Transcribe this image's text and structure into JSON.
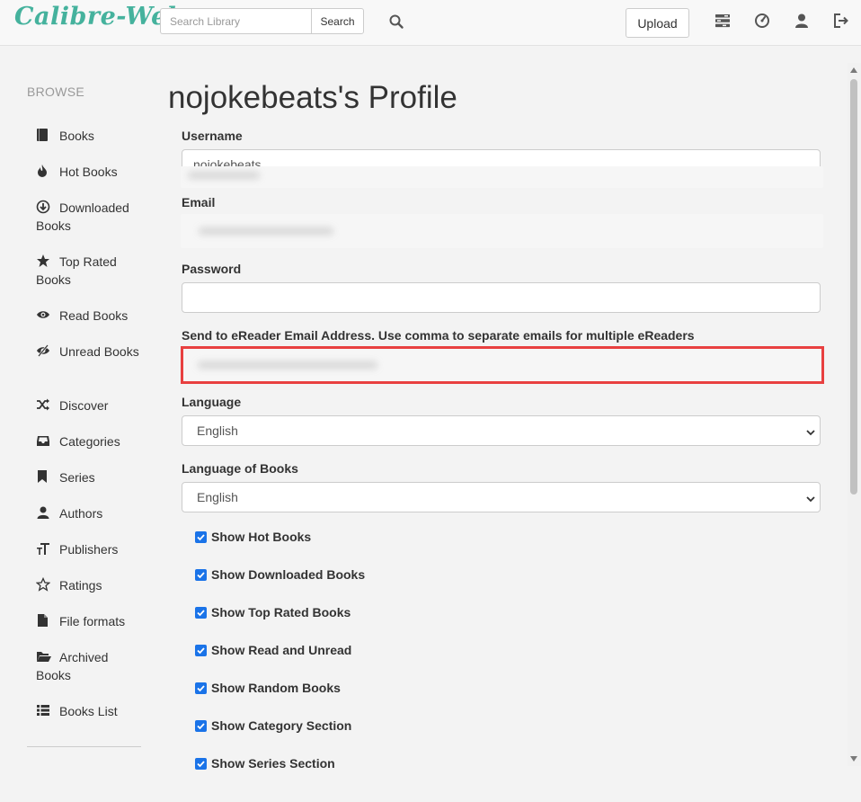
{
  "navbar": {
    "brand": "Calibre-Web",
    "search_placeholder": "Search Library",
    "search_button": "Search",
    "upload_button": "Upload",
    "icons": [
      "search-icon",
      "tasks-icon",
      "dashboard-icon",
      "user-icon",
      "logout-icon"
    ]
  },
  "sidebar": {
    "heading": "BROWSE",
    "items": [
      {
        "label": "Books",
        "icon": "book-icon"
      },
      {
        "label": "Hot Books",
        "icon": "fire-icon"
      },
      {
        "label": "Downloaded Books",
        "icon": "download-icon"
      },
      {
        "label": "Top Rated Books",
        "icon": "star-icon"
      },
      {
        "label": "Read Books",
        "icon": "eye-icon"
      },
      {
        "label": "Unread Books",
        "icon": "eye-off-icon"
      },
      {
        "label": "Discover",
        "icon": "shuffle-icon"
      },
      {
        "label": "Categories",
        "icon": "inbox-icon"
      },
      {
        "label": "Series",
        "icon": "bookmark-icon"
      },
      {
        "label": "Authors",
        "icon": "user-icon"
      },
      {
        "label": "Publishers",
        "icon": "text-size-icon"
      },
      {
        "label": "Ratings",
        "icon": "star-outline-icon"
      },
      {
        "label": "File formats",
        "icon": "file-icon"
      },
      {
        "label": "Archived Books",
        "icon": "folder-open-icon"
      },
      {
        "label": "Books List",
        "icon": "list-icon"
      }
    ]
  },
  "profile": {
    "title": "nojokebeats's Profile",
    "username_label": "Username",
    "username_value": "nojokebeats",
    "email_label": "Email",
    "password_label": "Password",
    "password_value": "",
    "ereader_label": "Send to eReader Email Address. Use comma to separate emails for multiple eReaders",
    "language_label": "Language",
    "language_value": "English",
    "books_language_label": "Language of Books",
    "books_language_value": "English",
    "checkboxes": [
      {
        "label": "Show Hot Books",
        "checked": true
      },
      {
        "label": "Show Downloaded Books",
        "checked": true
      },
      {
        "label": "Show Top Rated Books",
        "checked": true
      },
      {
        "label": "Show Read and Unread",
        "checked": true
      },
      {
        "label": "Show Random Books",
        "checked": true
      },
      {
        "label": "Show Category Section",
        "checked": true
      },
      {
        "label": "Show Series Section",
        "checked": true
      }
    ]
  },
  "colors": {
    "brand": "#45b29d",
    "checkbox": "#1a73e8",
    "highlight": "#e84040"
  }
}
